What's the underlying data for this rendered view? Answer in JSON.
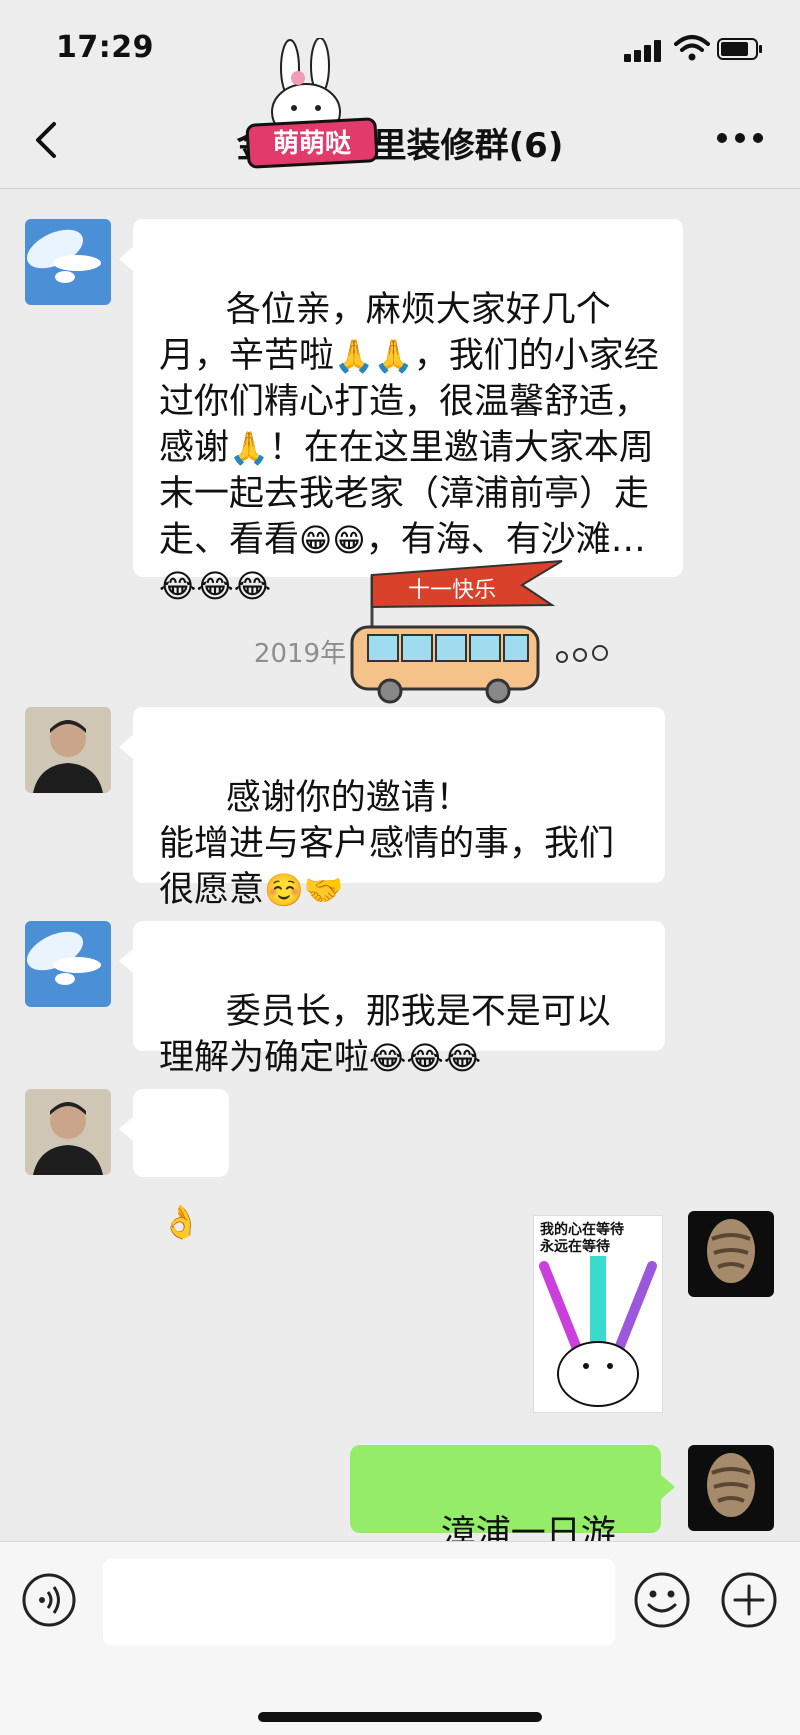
{
  "status_bar": {
    "time": "17:29"
  },
  "nav": {
    "title": "金　　　里装修群(6)",
    "sticker_text": "萌萌哒"
  },
  "messages": [
    {
      "side": "left",
      "avatar": "dove-avatar",
      "text": "各位亲，麻烦大家好几个月，辛苦啦",
      "emojis1": "🙏🙏",
      "text2": "，我们的小家经过你们精心打造，很温馨舒适，感谢",
      "emojis2": "🙏",
      "text3": "！在在这里邀请大家本周末一起去我老家（漳浦前亭）走走、看看",
      "emojis3": "😁😁",
      "text4": "，有海、有沙滩…",
      "emojis4": "😂😂😂"
    },
    {
      "side": "left",
      "avatar": "man-avatar",
      "text": "感谢你的邀请！\n能增进与客户感情的事，我们很愿意",
      "emojis": "☺️🤝"
    },
    {
      "side": "left",
      "avatar": "dove-avatar",
      "text": "委员长，那我是不是可以理解为确定啦",
      "emojis": "😂😂😂"
    },
    {
      "side": "left",
      "avatar": "man-avatar",
      "text": "",
      "emojis": "👌"
    },
    {
      "side": "right",
      "avatar": "statue-avatar",
      "sticker_text": "我的心在等待\n永远在等待"
    },
    {
      "side": "right",
      "avatar": "statue-avatar",
      "text": "漳浦一日游走起"
    }
  ],
  "timestamp": "2019年",
  "bus_sticker": {
    "flag_text": "十一快乐"
  },
  "input": {
    "placeholder": ""
  },
  "colors": {
    "background": "#ececec",
    "bubble_left": "#ffffff",
    "bubble_right": "#95ec69"
  }
}
